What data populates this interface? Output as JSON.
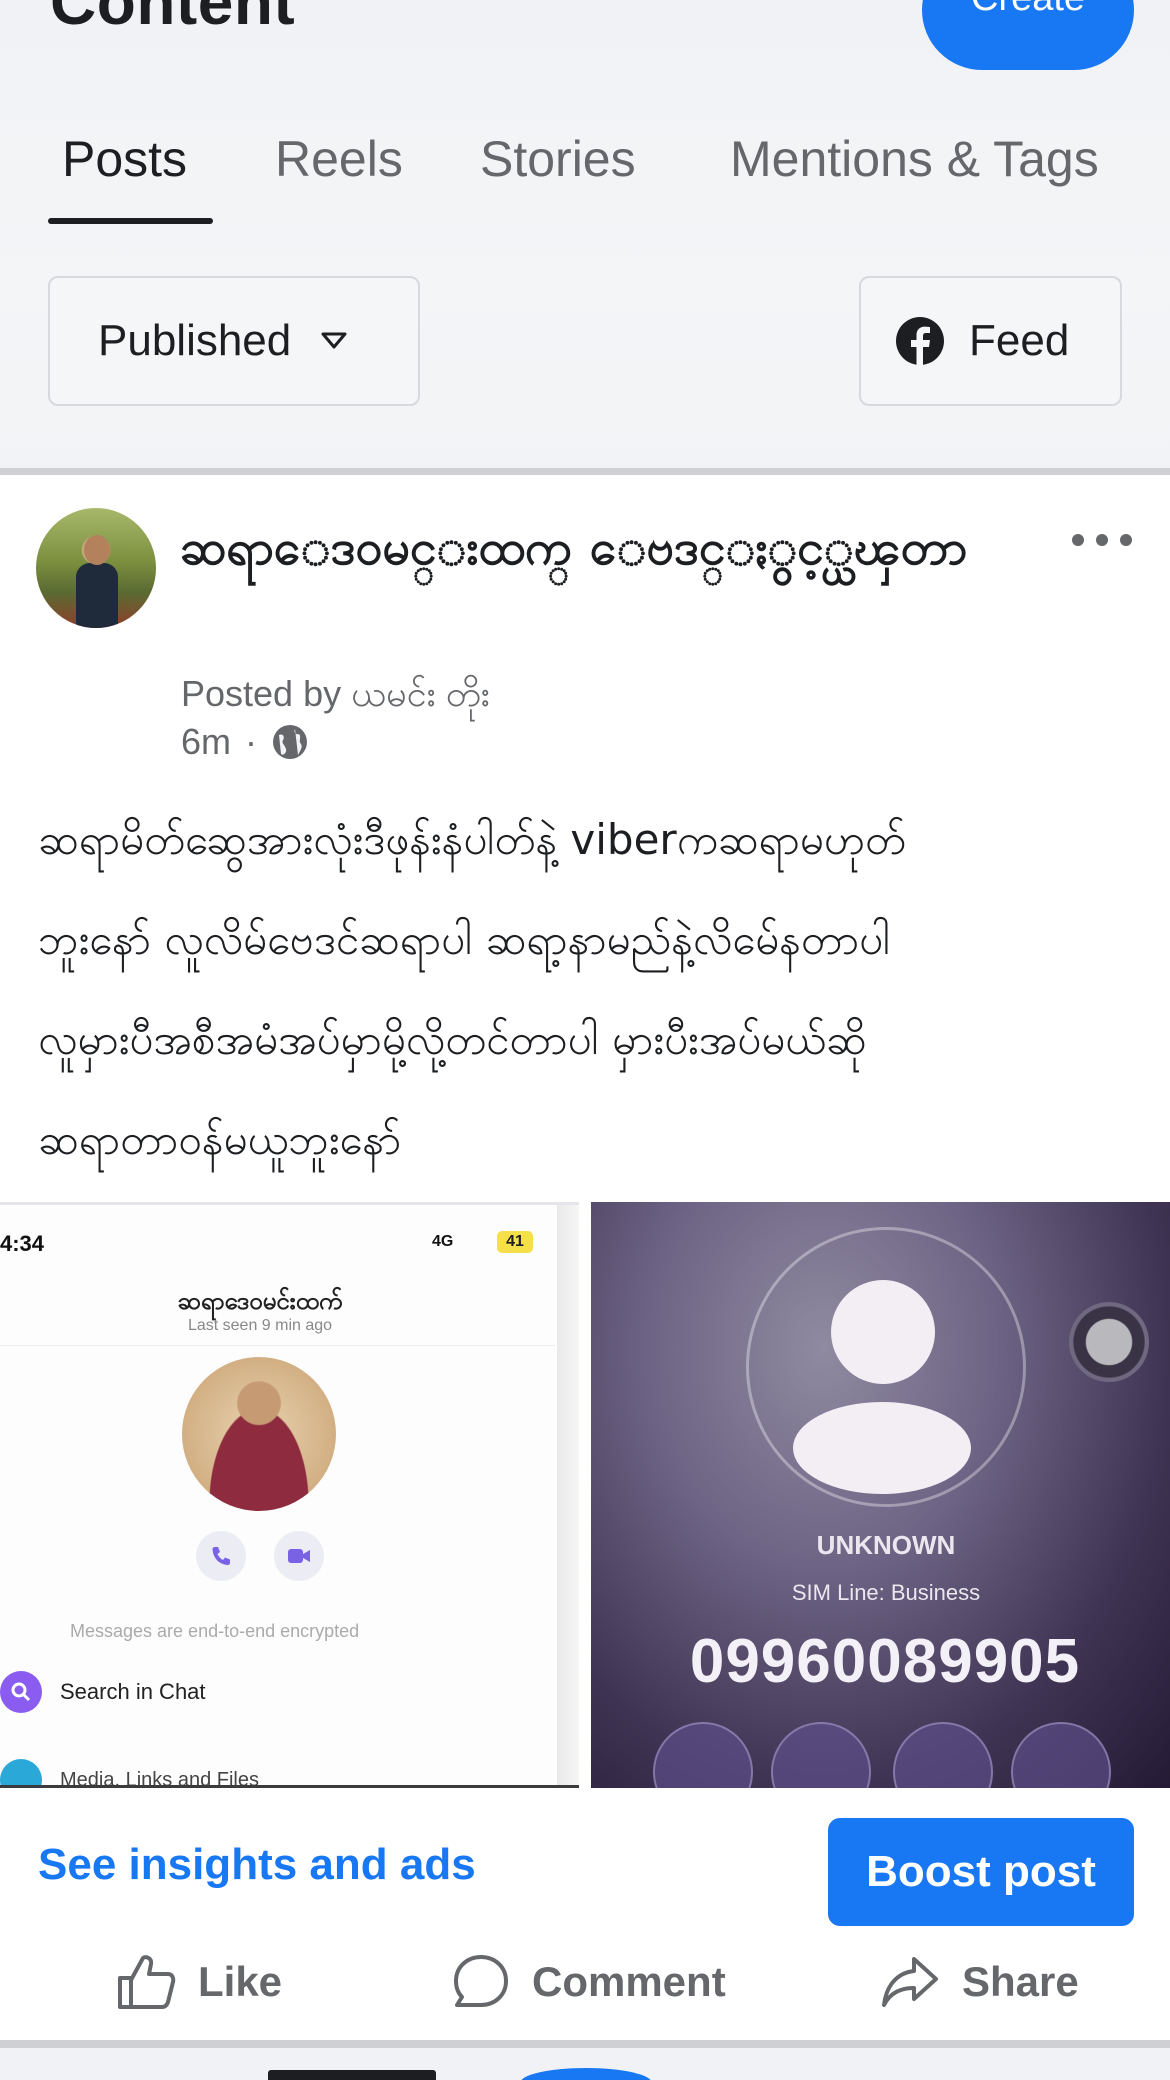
{
  "header": {
    "title": "Content",
    "create_label": "Create",
    "tabs": [
      {
        "label": "Posts",
        "active": true
      },
      {
        "label": "Reels",
        "active": false
      },
      {
        "label": "Stories",
        "active": false
      },
      {
        "label": "Mentions & Tags",
        "active": false
      }
    ],
    "filter_label": "Published",
    "feed_label": "Feed"
  },
  "post": {
    "author": "ဆရာေဒ၀မင္းထက္ ေဗဒင္ႏွင့္ယၾတာ",
    "posted_by": "Posted by ယမင်း တိုး",
    "time": "6m",
    "separator": "·",
    "text": "ဆရာမိတ်ဆွေအားလုံးဒီဖုန်းနံပါတ်နဲ့ viberကဆရာမဟုတ်\nဘူးနော် လူလိမ်ဗေဒင်ဆရာပါ ဆရာ့နာမည်နဲ့လိမ်ေနတာပါ\nလူမှားပီအစီအမံအပ်မှာမို့လို့တင်တာပါ မှားပီးအပ်မယ်ဆို\nဆရာတာ၀န်မယူဘူးနော်"
  },
  "screenshot_left": {
    "time": "4:34",
    "network": "4G",
    "battery": "41",
    "chat_name": "ဆရာဒေ၀မင်းထက်",
    "last_seen": "Last seen 9 min ago",
    "encrypted": "Messages are end-to-end encrypted",
    "search_label": "Search in Chat",
    "media_label": "Media, Links and Files"
  },
  "screenshot_right": {
    "caller": "UNKNOWN",
    "sim_line": "SIM Line:  Business",
    "number": "09960089905"
  },
  "actions": {
    "insights_label": "See insights and ads",
    "boost_label": "Boost post",
    "like_label": "Like",
    "comment_label": "Comment",
    "share_label": "Share"
  },
  "colors": {
    "accent": "#1877f2",
    "text_primary": "#1c1e21",
    "text_secondary": "#65676b"
  }
}
